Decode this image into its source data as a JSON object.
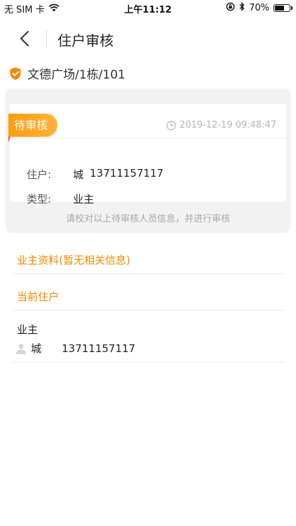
{
  "status_bar": {
    "carrier": "无 SIM 卡",
    "time": "上午11:12",
    "battery": "70%",
    "battery_level": 0.7
  },
  "nav": {
    "title": "住户审核"
  },
  "location": {
    "text": "文德广场/1栋/101"
  },
  "application": {
    "status": "待审核",
    "submitted_at": "2019-12-19 09:48:47",
    "resident_label": "住户:",
    "resident_name": "城",
    "resident_phone": "13711157117",
    "type_label": "类型:",
    "type_value": "业主",
    "hint": "请校对以上待审核人员信息，并进行审核"
  },
  "owner_section": {
    "title": "业主资料(暂无相关信息)"
  },
  "current_section": {
    "title": "当前住户",
    "residents": [
      {
        "role": "业主",
        "name": "城",
        "phone": "13711157117"
      }
    ]
  },
  "colors": {
    "accent": "#f08a00",
    "tag_gradient_start": "#ff9c10",
    "tag_gradient_end": "#ffb43a",
    "card_background": "#f2f2f2"
  },
  "icons": [
    "wifi-icon",
    "lock-rotation-icon",
    "bluetooth-icon",
    "back-chevron-icon",
    "shield-check-icon",
    "clock-icon",
    "user-avatar-icon"
  ]
}
